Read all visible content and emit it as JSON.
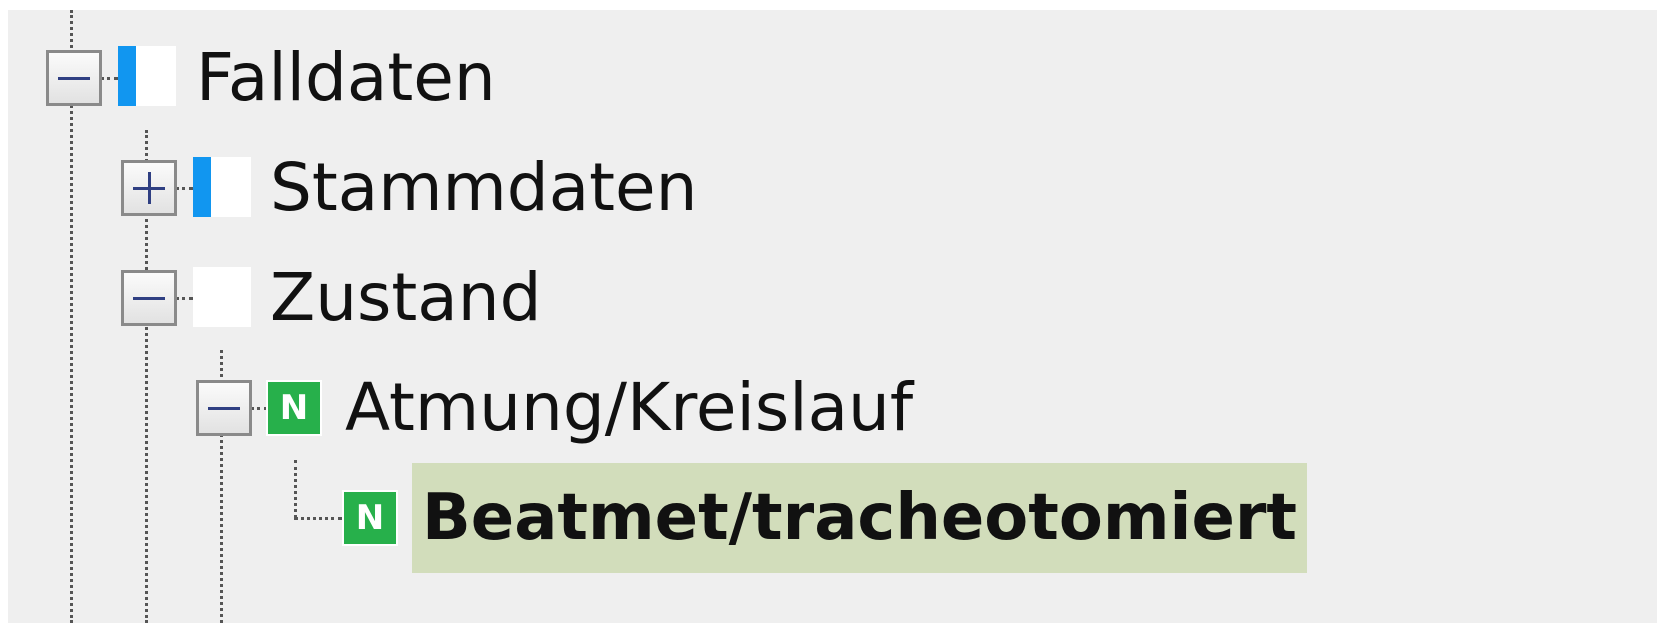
{
  "tree": {
    "nodes": [
      {
        "label": "Falldaten",
        "expander": "minus",
        "icon": "blue-strip-status-icon"
      },
      {
        "label": "Stammdaten",
        "expander": "plus",
        "icon": "blue-strip-status-icon"
      },
      {
        "label": "Zustand",
        "expander": "minus",
        "icon": "blank-status-icon"
      },
      {
        "label": "Atmung/Kreislauf",
        "expander": "minus",
        "icon": "n-badge-icon",
        "icon_text": "N"
      },
      {
        "label": "Beatmet/tracheotomiert",
        "expander": "none",
        "icon": "n-badge-icon",
        "icon_text": "N",
        "selected": true
      }
    ]
  },
  "colors": {
    "background": "#efefef",
    "selection": "#d2ddbb",
    "status_blue": "#1196f0",
    "badge_green": "#27b04b",
    "expander_glyph": "#2f3f82"
  }
}
